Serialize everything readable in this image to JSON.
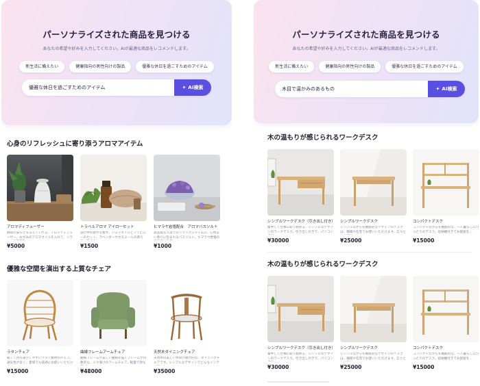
{
  "left": {
    "hero": {
      "title": "パーソナライズされた商品を見つける",
      "subtitle": "あなたの希望や好みを入力してください。AIが最適な商品をレコメンドします。",
      "chips": [
        "新生活に備えたい",
        "健康指向の男性向けの製品",
        "優雅な休日を過ごすためのアイテム"
      ],
      "search_value": "優雅な休日を過ごすためのアイテム",
      "search_button": "AI検索",
      "search_button_icon": "sparkle-icon"
    },
    "sections": [
      {
        "title": "心身のリフレッシュに寄り添うアロマアイテム",
        "items": [
          {
            "name": "アロマディフューザー",
            "desc": "静寂に安らぎを与えてくれる、アロマディフューザー。おがみのアロマオイルを入れて、リラックス空間を…",
            "price": "¥5000"
          },
          {
            "name": "トラベルアロマ アイロ一セット",
            "desc": "旅行中の疲れを癒す、アロマオイルとアイピロ一のセット。ラベンダーやカモミールの香りで、質の高い…",
            "price": "¥1500"
          },
          {
            "name": "ヒマラヤ岩塩配合　アロマバスソルト",
            "desc": "高品質な入浴でのリラックスタイムに、心地よい香りに包まれるバスソルト。ヒマラヤ岩塩の天然成分を使…",
            "price": "¥1000"
          }
        ]
      },
      {
        "title": "優雅な空間を演出する上質なチェア",
        "items": [
          {
            "name": "ラタンチェア",
            "desc": "軽くて持ち運びしやすいラタン素材のチェア。通気性が良く、夏場でも快適にお使いいただけます。",
            "price": "¥15000"
          },
          {
            "name": "曲線フレームアームチェア",
            "desc": "曲線フレームが美しい曲線を描くフレームが印象的な、人々受けのアームチェア。軽量で持ち運びも…",
            "price": "¥48000"
          },
          {
            "name": "天然木ダイニングチェア",
            "desc": "天然木の美しい木目が魅力的な、ダイニングチェアです。シンプルなデザインでどんなインテリアにも…",
            "price": "¥35000"
          }
        ]
      }
    ]
  },
  "right": {
    "hero": {
      "title": "パーソナライズされた商品を見つける",
      "subtitle": "あなたの希望や好みを入力してください。AIが最適な商品をレコメンドします。",
      "chips": [
        "新生活に備えたい",
        "健康指向の男性向けの製品",
        "優雅な休日を過ごすためのアイテム"
      ],
      "search_value": "木目で温かみのあるもの",
      "search_button": "AI検索",
      "search_button_icon": "sparkle-icon"
    },
    "sections": [
      {
        "title": "木の温もりが感じられるワークデスク",
        "items": [
          {
            "name": "シンプルワークデスク（引き出し付き）",
            "desc": "集中して仕事に取り組める、シンプルなデザインのワークデスク。引き出し付きで、パソコン作業…",
            "price": "¥30000"
          },
          {
            "name": "シンプルワークデスク",
            "desc": "シンプルながらも機能的なデザインのデスクは、職場や在宅でお使いいただけます。広々とした天板…",
            "price": "¥25000"
          },
          {
            "name": "コンパクトデスク",
            "desc": "コンパクトながらも機能的な、一人暮らしにぴったりのデスク。収納棚付きでお部屋を…",
            "price": "¥15000"
          }
        ]
      },
      {
        "title": "木の温もりが感じられるワークデスク",
        "items": [
          {
            "name": "シンプルワークデスク（引き出し付き）",
            "desc": "集中して仕事に取り組める、シンプルなデザインのワークデスク。引き出し付きで、パソコン作業…",
            "price": "¥30000"
          },
          {
            "name": "シンプルワークデスク",
            "desc": "シンプルながらも機能的なデザインのデスクは、職場や在宅でお使いいただけます。広々とした天板…",
            "price": "¥25000"
          },
          {
            "name": "コンパクトデスク",
            "desc": "コンパクトながらも機能的な、一人暮らしにぴったりのデスク。収納棚付きでお部屋を…",
            "price": "¥15000"
          }
        ]
      }
    ]
  }
}
